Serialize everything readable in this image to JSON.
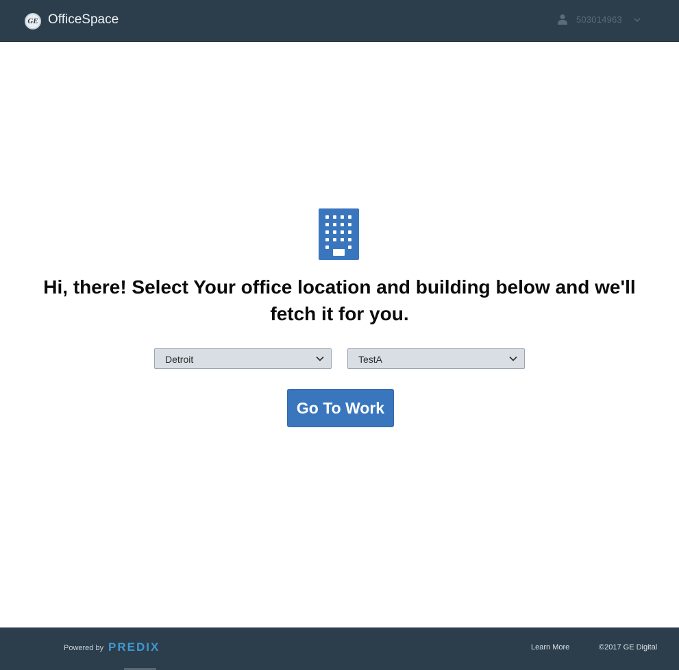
{
  "header": {
    "logo_text": "GE",
    "app_title": "OfficeSpace",
    "user_name": "503014963",
    "icons": [
      "ge-logo-icon",
      "user-icon",
      "chevron-down-icon"
    ]
  },
  "main": {
    "headline": "Hi, there! Select Your office location and building below and we'll fetch it for you.",
    "location_select": {
      "value": "Detroit"
    },
    "building_select": {
      "value": "TestA"
    },
    "go_button_label": "Go To Work",
    "icons": [
      "building-icon"
    ]
  },
  "footer": {
    "powered_by": "Powered by",
    "brand": "PREDIX",
    "learn_more": "Learn More",
    "copyright": "©2017 GE Digital"
  },
  "colors": {
    "header_bg": "#2c3e4c",
    "accent_blue": "#3a76bd",
    "select_bg": "#d8dee3",
    "predix_blue": "#3d9ad1"
  }
}
